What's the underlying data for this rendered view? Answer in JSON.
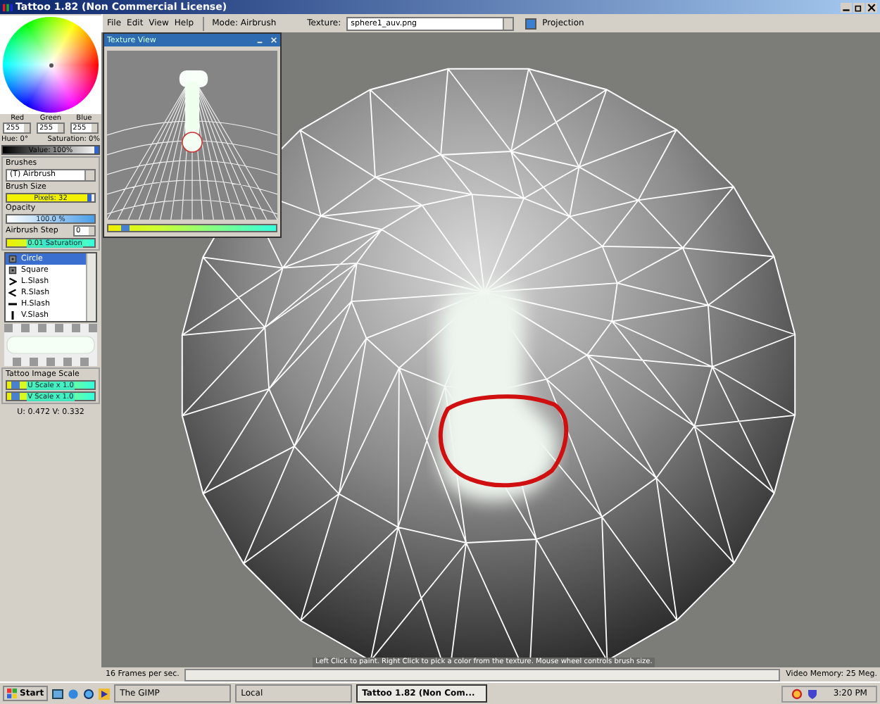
{
  "window": {
    "title": "Tattoo 1.82 (Non Commercial License)"
  },
  "color_picker": {
    "channels": [
      {
        "label": "Red",
        "value": "255"
      },
      {
        "label": "Green",
        "value": "255"
      },
      {
        "label": "Blue",
        "value": "255"
      }
    ],
    "hue": "Hue: 0°",
    "saturation": "Saturation: 0%",
    "value": {
      "label": "Value: 100%",
      "level": 1
    }
  },
  "brushes": {
    "title": "Brushes",
    "type": "(T) Airbrush",
    "sliders": [
      {
        "title": "Brush Size",
        "reading": "Pixels: 32",
        "level": 0.96,
        "kind": "yellow"
      },
      {
        "title": "Opacity",
        "reading": "100.0 %",
        "level": 1,
        "kind": "blue"
      }
    ],
    "airbrush_step": {
      "label": "Airbrush Step",
      "value": "0"
    },
    "saturation_slider": {
      "reading": "0.01 Saturation",
      "level": 0.45
    },
    "shapes": [
      {
        "label": "Circle",
        "selected": true,
        "kind": "circle"
      },
      {
        "label": "Square",
        "selected": false,
        "kind": "square"
      },
      {
        "label": "L.Slash",
        "selected": false,
        "kind": "lslash"
      },
      {
        "label": "R.Slash",
        "selected": false,
        "kind": "rslash"
      },
      {
        "label": "H.Slash",
        "selected": false,
        "kind": "hslash"
      },
      {
        "label": "V.Slash",
        "selected": false,
        "kind": "vslash"
      }
    ]
  },
  "image_scale": {
    "title": "Tattoo Image Scale",
    "sliders": [
      {
        "reading": "U Scale x 1.0",
        "level": 0.1
      },
      {
        "reading": "V Scale x 1.0",
        "level": 0.1
      }
    ]
  },
  "uv_readout": "U: 0.472  V: 0.332",
  "menu": [
    "File",
    "Edit",
    "View",
    "Help"
  ],
  "mode": "Mode: Airbrush",
  "texture": {
    "label": "Texture:",
    "value": "sphere1_auv.png"
  },
  "projection": {
    "label": "Projection",
    "checked": true
  },
  "texture_view": {
    "title": "Texture View",
    "level": 0.1
  },
  "viewport": {
    "hint": "Left Click to paint. Right Click to pick a color from the texture. Mouse wheel controls brush size."
  },
  "status_bar": {
    "fps": "16 Frames per sec.",
    "memory": "Video Memory: 25 Meg."
  },
  "taskbar": {
    "start": "Start",
    "tasks": [
      {
        "label": "The GIMP",
        "selected": false
      },
      {
        "label": "Local",
        "selected": false
      },
      {
        "label": "Tattoo 1.82 (Non Com...",
        "selected": true
      }
    ],
    "clock": "3:20 PM"
  }
}
